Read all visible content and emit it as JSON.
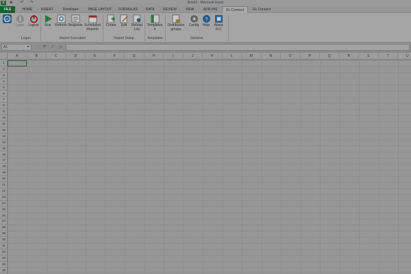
{
  "window": {
    "title": "Book3 - Microsoft Excel"
  },
  "tabs": [
    {
      "label": "FILE"
    },
    {
      "label": "HOME"
    },
    {
      "label": "INSERT"
    },
    {
      "label": "Developer"
    },
    {
      "label": "PAGE LAYOUT"
    },
    {
      "label": "FORMULAS"
    },
    {
      "label": "DATA"
    },
    {
      "label": "REVIEW"
    },
    {
      "label": "VIEW"
    },
    {
      "label": "ADD-INS"
    },
    {
      "label": "XL Connect"
    },
    {
      "label": "GL Connect"
    }
  ],
  "active_tab": "XL Connect",
  "ribbon": {
    "logon_group": {
      "label": "Logon",
      "login": "Login",
      "logout": "Logout"
    },
    "report_exec_group": {
      "label": "Report Execution",
      "run": "Run",
      "refresh": "Refresh",
      "requests": "Requests",
      "scheduled_1": "Scheduled",
      "scheduled_2": "Reports"
    },
    "report_setup_group": {
      "label": "Report Setup",
      "create": "Create",
      "edit": "Edit",
      "reload_1": "Reload",
      "reload_2": "List"
    },
    "templates_group": {
      "label": "Templates",
      "templates_1": "Templates",
      "templates_2": "▾"
    },
    "general_group": {
      "label": "General",
      "distribution_1": "Distribution",
      "distribution_2": "groups",
      "config": "Config",
      "help": "Help",
      "about_1": "About",
      "about_2": "XLC"
    }
  },
  "formula_bar": {
    "name_box": "A1",
    "cancel": "✕",
    "enter": "✓",
    "fx": "fx",
    "value": ""
  },
  "columns": [
    "A",
    "B",
    "C",
    "D",
    "E",
    "F",
    "G",
    "H",
    "I",
    "J",
    "K",
    "L",
    "M",
    "N",
    "O",
    "P",
    "Q",
    "R",
    "S",
    "T",
    "U"
  ],
  "rows": [
    "1",
    "2",
    "3",
    "4",
    "5",
    "6",
    "7",
    "8",
    "9",
    "10",
    "11",
    "12",
    "13",
    "14",
    "15",
    "16",
    "17",
    "18",
    "19",
    "20",
    "21",
    "22",
    "23",
    "24",
    "25",
    "26",
    "27",
    "28",
    "29",
    "30",
    "31",
    "32",
    "33",
    "34",
    "35"
  ],
  "colors": {
    "excel_green": "#1d5c34",
    "run_green": "#2a7a3a",
    "logout_red": "#8e1e1e",
    "help_blue": "#2a5a8a"
  }
}
